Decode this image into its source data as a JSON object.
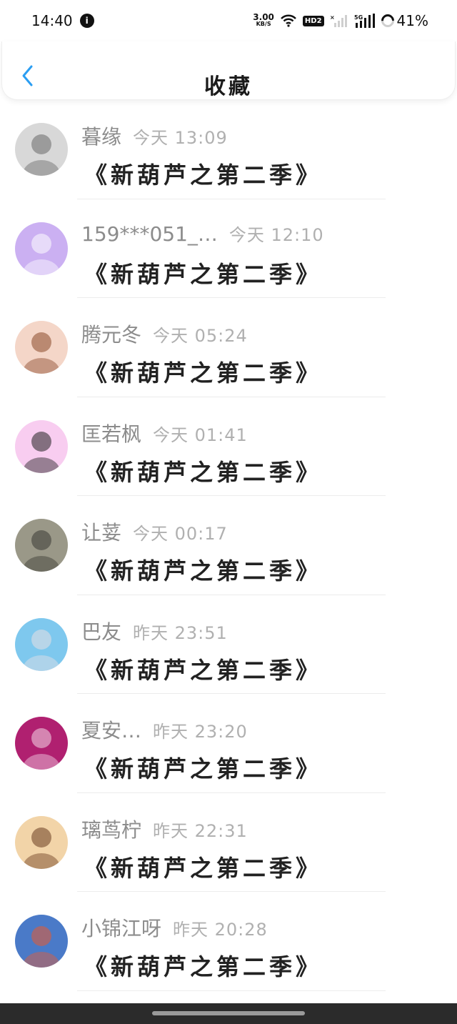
{
  "status_bar": {
    "time": "14:40",
    "notification_glyph": "i",
    "net_speed_value": "3.00",
    "net_speed_unit": "KB/S",
    "hd_badge": "HD2",
    "network": "5G",
    "battery": "41%"
  },
  "header": {
    "back_icon": "chevron-left-icon",
    "title": "收藏",
    "accent_color": "#2b9ef2"
  },
  "items": [
    {
      "name": "暮缘",
      "time": "今天 13:09",
      "content": "《新葫芦之第二季》",
      "avatar_colors": [
        "#d8d8d8",
        "#6a6a6a"
      ]
    },
    {
      "name": "159***051_…",
      "time": "今天 12:10",
      "content": "《新葫芦之第二季》",
      "avatar_colors": [
        "#cbb0f2",
        "#ffffff"
      ]
    },
    {
      "name": "腾元冬",
      "time": "今天 05:24",
      "content": "《新葫芦之第二季》",
      "avatar_colors": [
        "#f4d6c8",
        "#8a4a2a"
      ]
    },
    {
      "name": "匡若枫",
      "time": "今天 01:41",
      "content": "《新葫芦之第二季》",
      "avatar_colors": [
        "#f8cdf0",
        "#222222"
      ]
    },
    {
      "name": "让荽",
      "time": "今天 00:17",
      "content": "《新葫芦之第二季》",
      "avatar_colors": [
        "#9a9888",
        "#3a3a34"
      ]
    },
    {
      "name": "巴友",
      "time": "昨天 23:51",
      "content": "《新葫芦之第二季》",
      "avatar_colors": [
        "#7ec8ee",
        "#e8e0e4"
      ]
    },
    {
      "name": "夏安…",
      "time": "昨天 23:20",
      "content": "《新葫芦之第二季》",
      "avatar_colors": [
        "#b02070",
        "#f4d8e8"
      ]
    },
    {
      "name": "璃茑柠",
      "time": "昨天 22:31",
      "content": "《新葫芦之第二季》",
      "avatar_colors": [
        "#f2d4a8",
        "#6a3c20"
      ]
    },
    {
      "name": "小锦江呀",
      "time": "昨天 20:28",
      "content": "《新葫芦之第二季》",
      "avatar_colors": [
        "#4a7ac8",
        "#e85a30"
      ]
    }
  ]
}
